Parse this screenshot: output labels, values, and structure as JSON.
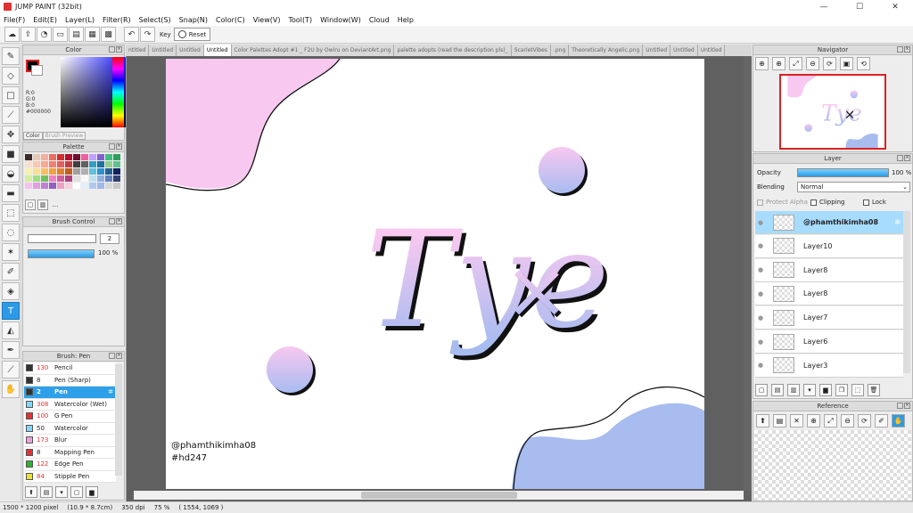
{
  "app": {
    "title": "JUMP PAINT (32bit)"
  },
  "window_buttons": [
    "—",
    "☐",
    "✕"
  ],
  "menu": [
    "File(F)",
    "Edit(E)",
    "Layer(L)",
    "Filter(R)",
    "Select(S)",
    "Snap(N)",
    "Color(C)",
    "View(V)",
    "Tool(T)",
    "Window(W)",
    "Cloud",
    "Help"
  ],
  "toolbar": {
    "key_label": "Key",
    "reset_label": "Reset"
  },
  "color_panel": {
    "title": "Color",
    "r": "R:0",
    "g": "G:0",
    "b": "B:0",
    "hex": "#000000",
    "tabs": [
      "Color",
      "Brush Preview"
    ]
  },
  "palette_panel": {
    "title": "Palette",
    "colors": [
      "#3a2a28",
      "#e8c9b8",
      "#f0b0a0",
      "#e87060",
      "#d03030",
      "#b01030",
      "#701030",
      "#f060a0",
      "#c0a0ff",
      "#8060d0",
      "#40c080",
      "#30a060",
      "#f8e0d0",
      "#f8c8b0",
      "#f8a890",
      "#f08070",
      "#e06060",
      "#c04040",
      "#404040",
      "#606060",
      "#30a0c0",
      "#2070a0",
      "#90d090",
      "#60c090",
      "#f8f0b0",
      "#f8e090",
      "#f8c060",
      "#f0a040",
      "#e08030",
      "#c06020",
      "#a0a0a0",
      "#b0b0b0",
      "#60c0e0",
      "#3090d0",
      "#206090",
      "#102060",
      "#d0f0a0",
      "#a0e080",
      "#70c060",
      "#f080c0",
      "#d060a0",
      "#b04080",
      "#e0e0e0",
      "#f8f8f8",
      "#c0e0f0",
      "#90b0e0",
      "#6080c0",
      "#304070",
      "#f8c0f0",
      "#e0a0e0",
      "#c080d0",
      "#9060c0",
      "#f0a0c0",
      "#f8d0e0",
      "#ffffff",
      "#e0f0ff",
      "#b0c8f0",
      "#a0b8e8",
      "#d8d8d8",
      "#c8c8c8"
    ],
    "more": "..."
  },
  "brush_control": {
    "title": "Brush Control",
    "size_value": "2",
    "size_fill": 0.0,
    "opacity_value": "100 %",
    "opacity_fill": 1.0
  },
  "brush_panel": {
    "title": "Brush: Pen",
    "items": [
      {
        "size": "130",
        "name": "Pencil",
        "color": "#333333",
        "size_red": true
      },
      {
        "size": "8",
        "name": "Pen (Sharp)",
        "color": "#333333",
        "size_red": false
      },
      {
        "size": "2",
        "name": "Pen",
        "color": "#333333",
        "size_red": true,
        "selected": true
      },
      {
        "size": "308",
        "name": "Watercolor (Wet)",
        "color": "#7fd8ff",
        "size_red": true
      },
      {
        "size": "100",
        "name": "G Pen",
        "color": "#e83030",
        "size_red": true
      },
      {
        "size": "50",
        "name": "Watercolor",
        "color": "#7fd8ff",
        "size_red": false
      },
      {
        "size": "173",
        "name": "Blur",
        "color": "#f0a0e0",
        "size_red": true
      },
      {
        "size": "8",
        "name": "Mapping Pen",
        "color": "#e83030",
        "size_red": false
      },
      {
        "size": "122",
        "name": "Edge Pen",
        "color": "#30b030",
        "size_red": true
      },
      {
        "size": "84",
        "name": "Stipple Pen",
        "color": "#f0e030",
        "size_red": true
      }
    ]
  },
  "tabs": [
    "ntitled",
    "Untitled",
    "Untitled",
    "Untitled",
    "Color Palettes Adopt #1 _ F2U by Owiru on DeviantArt.png",
    "palette adopts (read the description pls)_",
    "ScarletVibes",
    ".png",
    "Theoretically Angelic.png",
    "Untitled",
    "Untitled",
    "Untitled"
  ],
  "artwork": {
    "main_text": "Tye",
    "mark": "×",
    "credit_handle": "@phamthikimha08",
    "credit_tag": "#hd247",
    "pink": "#f8c8f0",
    "blue": "#a8bcf0"
  },
  "navigator": {
    "title": "Navigator"
  },
  "layer_panel": {
    "title": "Layer",
    "opacity_label": "Opacity",
    "opacity_value": "100 %",
    "blending_label": "Blending",
    "blending_value": "Normal",
    "protect_alpha": "Protect Alpha",
    "clipping": "Clipping",
    "lock": "Lock",
    "layers": [
      {
        "name": "@phamthikimha08",
        "selected": true
      },
      {
        "name": "Layer10"
      },
      {
        "name": "Layer8"
      },
      {
        "name": "Layer8"
      },
      {
        "name": "Layer7"
      },
      {
        "name": "Layer6"
      },
      {
        "name": "Layer3"
      }
    ]
  },
  "reference": {
    "title": "Reference"
  },
  "status": {
    "size": "1500 * 1200 pixel",
    "cm": "(10.9 * 8.7cm)",
    "dpi": "350 dpi",
    "zoom": "75 %",
    "coords": "( 1554, 1069 )"
  }
}
